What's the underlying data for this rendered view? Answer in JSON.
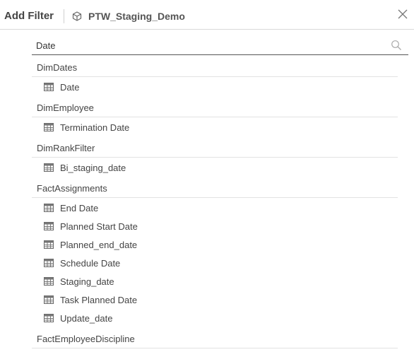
{
  "header": {
    "title": "Add Filter",
    "datasource_icon": "cube-icon",
    "datasource": "PTW_Staging_Demo",
    "close_icon": "close-icon"
  },
  "search": {
    "value": "Date",
    "placeholder": "",
    "icon": "search-icon"
  },
  "groups": [
    {
      "name": "DimDates",
      "fields": [
        "Date"
      ]
    },
    {
      "name": "DimEmployee",
      "fields": [
        "Termination Date"
      ]
    },
    {
      "name": "DimRankFilter",
      "fields": [
        "Bi_staging_date"
      ]
    },
    {
      "name": "FactAssignments",
      "fields": [
        "End Date",
        "Planned Start Date",
        "Planned_end_date",
        "Schedule Date",
        "Staging_date",
        "Task Planned Date",
        "Update_date"
      ]
    },
    {
      "name": "FactEmployeeDiscipline",
      "fields": []
    }
  ],
  "field_icon": "table-icon"
}
